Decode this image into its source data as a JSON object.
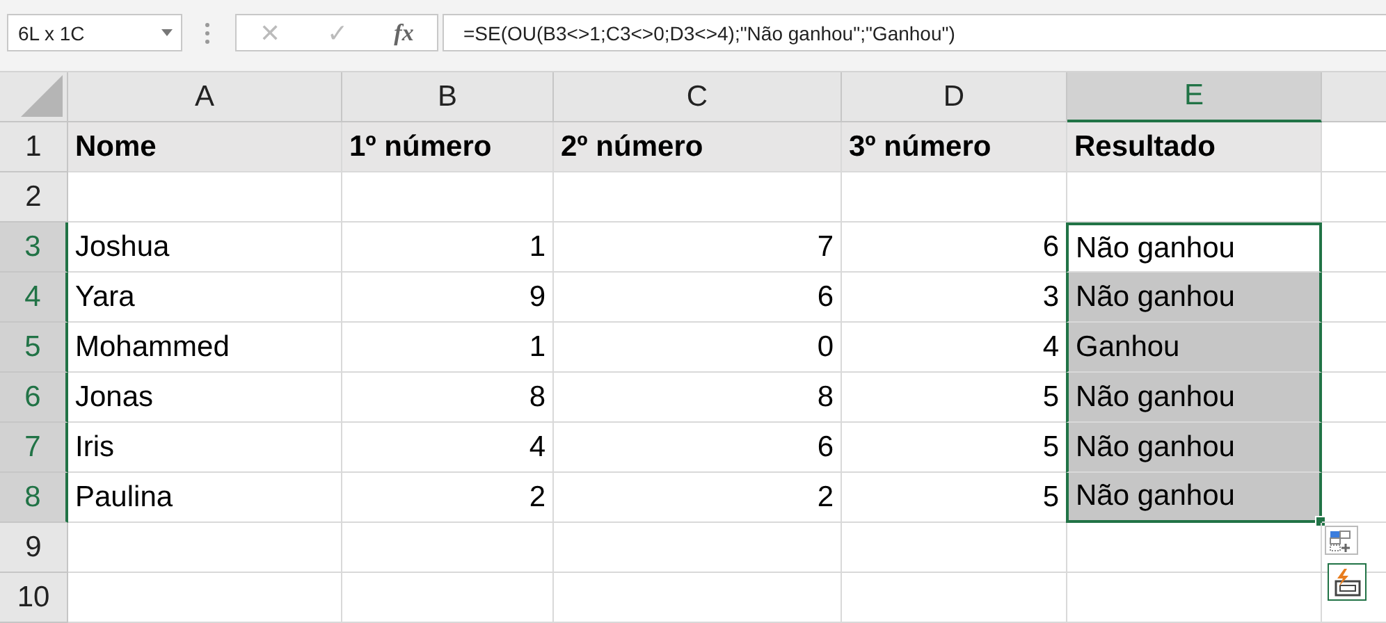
{
  "name_box": {
    "value": "6L x 1C"
  },
  "formula_bar": {
    "cancel": "✕",
    "enter": "✓",
    "function": "fx",
    "value": "=SE(OU(B3<>1;C3<>0;D3<>4);\"Não ganhou\";\"Ganhou\")"
  },
  "columns": [
    {
      "letter": "A",
      "selected": false
    },
    {
      "letter": "B",
      "selected": false
    },
    {
      "letter": "C",
      "selected": false
    },
    {
      "letter": "D",
      "selected": false
    },
    {
      "letter": "E",
      "selected": true
    }
  ],
  "rows": [
    {
      "number": "1",
      "selected": false,
      "kind": "header",
      "cells": [
        {
          "text": "Nome",
          "selected": false
        },
        {
          "text": "1º número",
          "selected": false
        },
        {
          "text": "2º número",
          "selected": false
        },
        {
          "text": "3º número",
          "selected": false
        },
        {
          "text": "Resultado",
          "selected": false
        }
      ]
    },
    {
      "number": "2",
      "selected": false,
      "kind": "blank",
      "cells": []
    },
    {
      "number": "3",
      "selected": true,
      "kind": "data",
      "cells": [
        {
          "text": "Joshua",
          "selected": false
        },
        {
          "text": "1",
          "selected": false
        },
        {
          "text": "7",
          "selected": false
        },
        {
          "text": "6",
          "selected": false
        },
        {
          "text": "Não ganhou",
          "selected": true,
          "active": true
        }
      ]
    },
    {
      "number": "4",
      "selected": true,
      "kind": "data",
      "cells": [
        {
          "text": "Yara",
          "selected": false
        },
        {
          "text": "9",
          "selected": false
        },
        {
          "text": "6",
          "selected": false
        },
        {
          "text": "3",
          "selected": false
        },
        {
          "text": "Não ganhou",
          "selected": true,
          "active": false
        }
      ]
    },
    {
      "number": "5",
      "selected": true,
      "kind": "data",
      "cells": [
        {
          "text": "Mohammed",
          "selected": false
        },
        {
          "text": "1",
          "selected": false
        },
        {
          "text": "0",
          "selected": false
        },
        {
          "text": "4",
          "selected": false
        },
        {
          "text": "Ganhou",
          "selected": true,
          "active": false
        }
      ]
    },
    {
      "number": "6",
      "selected": true,
      "kind": "data",
      "cells": [
        {
          "text": "Jonas",
          "selected": false
        },
        {
          "text": "8",
          "selected": false
        },
        {
          "text": "8",
          "selected": false
        },
        {
          "text": "5",
          "selected": false
        },
        {
          "text": "Não ganhou",
          "selected": true,
          "active": false
        }
      ]
    },
    {
      "number": "7",
      "selected": true,
      "kind": "data",
      "cells": [
        {
          "text": "Iris",
          "selected": false
        },
        {
          "text": "4",
          "selected": false
        },
        {
          "text": "6",
          "selected": false
        },
        {
          "text": "5",
          "selected": false
        },
        {
          "text": "Não ganhou",
          "selected": true,
          "active": false
        }
      ]
    },
    {
      "number": "8",
      "selected": true,
      "kind": "data",
      "cells": [
        {
          "text": "Paulina",
          "selected": false
        },
        {
          "text": "2",
          "selected": false
        },
        {
          "text": "2",
          "selected": false
        },
        {
          "text": "5",
          "selected": false
        },
        {
          "text": "Não ganhou",
          "selected": true,
          "active": false
        }
      ]
    },
    {
      "number": "9",
      "selected": false,
      "kind": "blank",
      "cells": []
    },
    {
      "number": "10",
      "selected": false,
      "kind": "blank",
      "cells": []
    }
  ]
}
